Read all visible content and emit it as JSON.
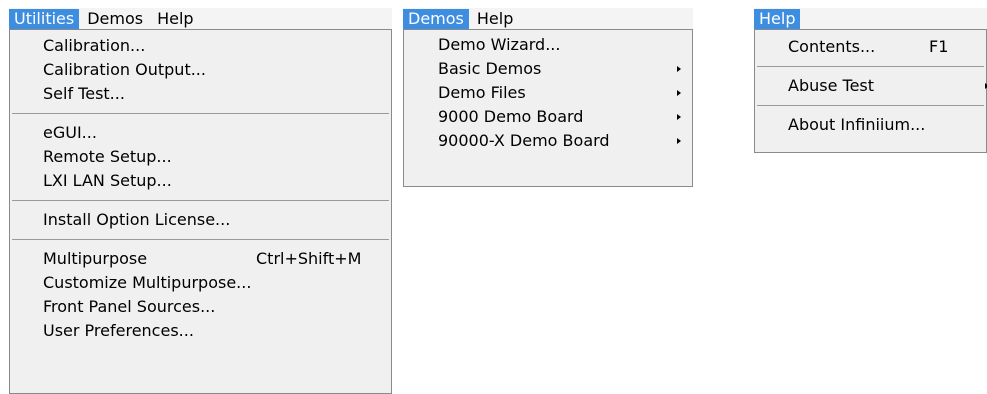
{
  "menus": {
    "utilities": {
      "bar": [
        "Utilities",
        "Demos",
        "Help"
      ],
      "groups": [
        [
          {
            "label": "Calibration..."
          },
          {
            "label": "Calibration Output..."
          },
          {
            "label": "Self Test..."
          }
        ],
        [
          {
            "label": "eGUI..."
          },
          {
            "label": "Remote Setup..."
          },
          {
            "label": "LXI LAN Setup..."
          }
        ],
        [
          {
            "label": "Install Option License..."
          }
        ],
        [
          {
            "label": "Multipurpose",
            "shortcut": "Ctrl+Shift+M"
          },
          {
            "label": "Customize Multipurpose..."
          },
          {
            "label": "Front Panel Sources..."
          },
          {
            "label": "User Preferences..."
          }
        ]
      ]
    },
    "demos": {
      "bar": [
        "Demos",
        "Help"
      ],
      "groups": [
        [
          {
            "label": "Demo Wizard..."
          },
          {
            "label": "Basic Demos",
            "submenu": true
          },
          {
            "label": "Demo Files",
            "submenu": true
          },
          {
            "label": "9000 Demo Board",
            "submenu": true
          },
          {
            "label": "90000-X Demo Board",
            "submenu": true
          }
        ]
      ]
    },
    "help": {
      "bar": [
        "Help"
      ],
      "groups": [
        [
          {
            "label": "Contents...",
            "shortcut": "F1"
          }
        ],
        [
          {
            "label": "Abuse Test",
            "submenu": true
          }
        ],
        [
          {
            "label": "About Infiniium..."
          }
        ]
      ]
    }
  },
  "colors": {
    "highlight": "#3d8ee0",
    "menu_background": "#f0f0f0",
    "menubar_background": "#f4f4f4"
  }
}
